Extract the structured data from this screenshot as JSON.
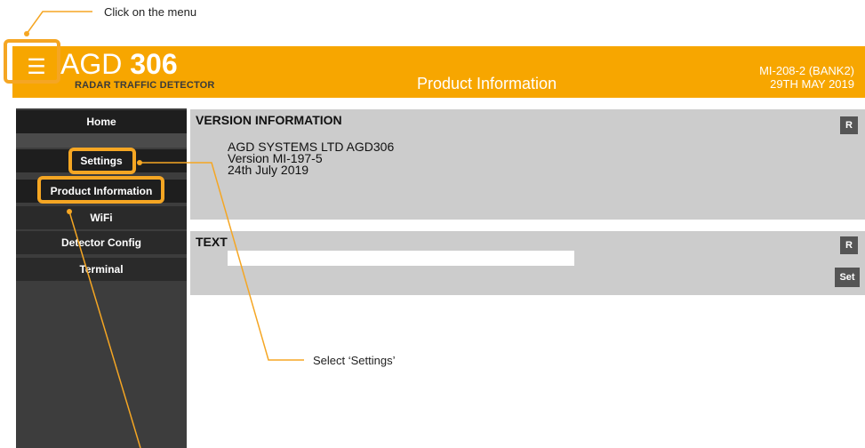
{
  "header": {
    "logo_prefix": "AGD",
    "logo_number": "306",
    "logo_subtitle": "RADAR TRAFFIC DETECTOR",
    "page_title": "Product Information",
    "device_id": "MI-208-2 (BANK2)",
    "date": "29TH MAY 2019",
    "menu_icon": "☰"
  },
  "sidebar": {
    "items": [
      {
        "label": "Home"
      },
      {
        "label": "Settings"
      },
      {
        "label": "Product Information"
      },
      {
        "label": "WiFi"
      },
      {
        "label": "Detector Config"
      },
      {
        "label": "Terminal"
      }
    ]
  },
  "version_panel": {
    "title": "VERSION INFORMATION",
    "line1": "AGD SYSTEMS LTD AGD306",
    "line2": "Version MI-197-5",
    "line3": "24th July 2019",
    "refresh_label": "R"
  },
  "text_panel": {
    "title": "TEXT",
    "input_value": "",
    "refresh_label": "R",
    "set_label": "Set"
  },
  "annotations": {
    "step1": "Click on the menu",
    "step2": "Select ‘Settings’"
  },
  "colors": {
    "brand_orange": "#f7a600",
    "annotation_orange": "#f5a623",
    "sidebar_bg": "#3d3d3d",
    "panel_bg": "#cccccc"
  }
}
